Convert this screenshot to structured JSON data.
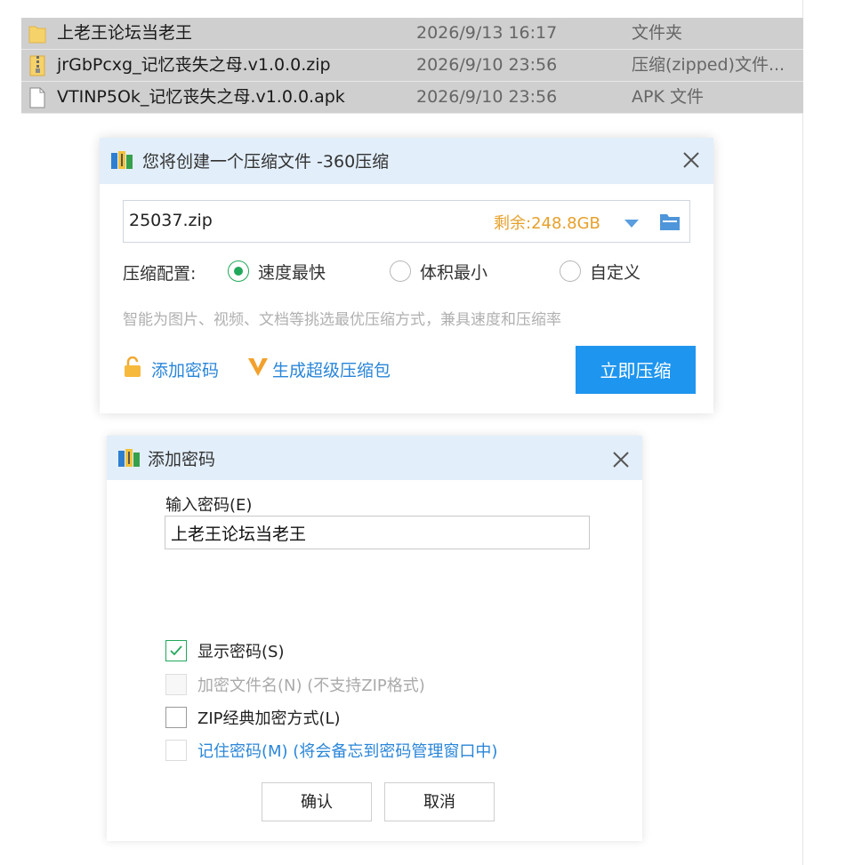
{
  "file_list": [
    {
      "icon": "folder-icon",
      "name": "上老王论坛当老王",
      "date": "2026/9/13 16:17",
      "type": "文件夹"
    },
    {
      "icon": "zip-file-icon",
      "name": "jrGbPcxg_记忆丧失之母.v1.0.0.zip",
      "date": "2026/9/10 23:56",
      "type": "压缩(zipped)文件..."
    },
    {
      "icon": "apk-file-icon",
      "name": "VTINP5Ok_记忆丧失之母.v1.0.0.apk",
      "date": "2026/9/10 23:56",
      "type": "APK 文件"
    }
  ],
  "compress_dialog": {
    "title": "您将创建一个压缩文件 -360压缩",
    "filename": "25037.zip",
    "free_space": "剩余:248.8GB",
    "config_label": "压缩配置:",
    "options": [
      {
        "label": "速度最快",
        "selected": true
      },
      {
        "label": "体积最小",
        "selected": false
      },
      {
        "label": "自定义",
        "selected": false
      }
    ],
    "hint": "智能为图片、视频、文档等挑选最优压缩方式，兼具速度和压缩率",
    "add_password_link": "添加密码",
    "super_package_link": "生成超级压缩包",
    "compress_button": "立即压缩",
    "accent_color": "#1e96f0",
    "free_space_color": "#e6a02a"
  },
  "password_dialog": {
    "title": "添加密码",
    "input_label": "输入密码(E)",
    "password_value": "上老王论坛当老王",
    "checkboxes": [
      {
        "label": "显示密码(S)",
        "checked": true,
        "enabled": true
      },
      {
        "label": "加密文件名(N) (不支持ZIP格式)",
        "checked": false,
        "enabled": false
      },
      {
        "label": "ZIP经典加密方式(L)",
        "checked": false,
        "enabled": true
      },
      {
        "label": "记住密码(M) (将会备忘到密码管理窗口中)",
        "checked": false,
        "enabled": true
      }
    ],
    "ok_button": "确认",
    "cancel_button": "取消",
    "check_color": "#22a85a"
  }
}
